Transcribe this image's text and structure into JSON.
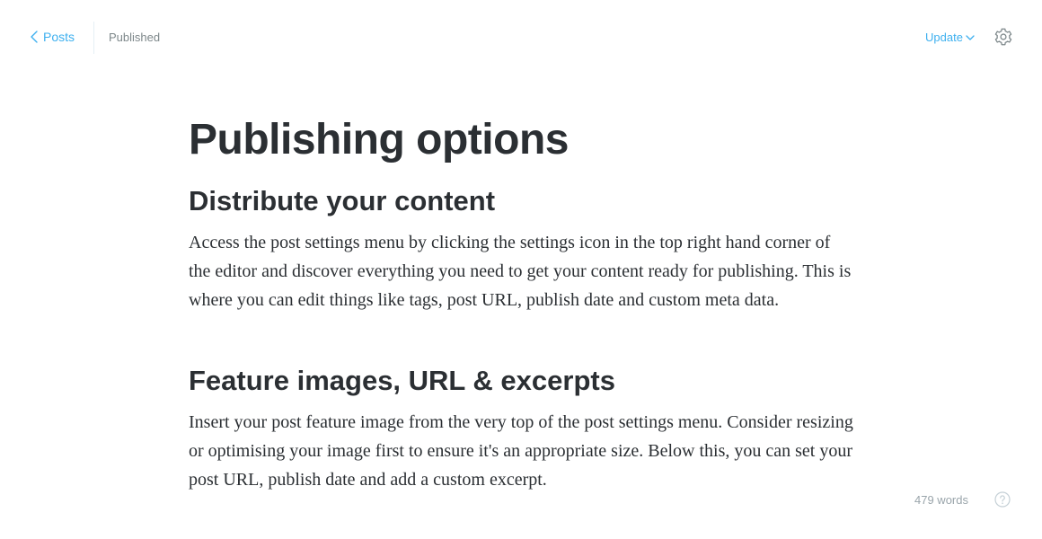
{
  "header": {
    "back_label": "Posts",
    "status": "Published",
    "update_label": "Update"
  },
  "icons": {
    "back": "chevron-left-icon",
    "dropdown": "chevron-down-icon",
    "settings": "gear-icon",
    "help": "help-icon"
  },
  "colors": {
    "accent": "#3eb0ef",
    "text": "#2b2f33",
    "muted": "#7d878a"
  },
  "post": {
    "title": "Publishing options",
    "sections": [
      {
        "heading": "Distribute your content",
        "body": "Access the post settings menu by clicking the settings icon in the top right hand corner of the editor and discover everything you need to get your content ready for publishing. This is where you can edit things like tags, post URL, publish date and custom meta data."
      },
      {
        "heading": "Feature images, URL & excerpts",
        "body": "Insert your post feature image from the very top of the post settings menu. Consider resizing or optimising your image first to ensure it's an appropriate size. Below this, you can set your post URL, publish date and add a custom excerpt."
      }
    ]
  },
  "footer": {
    "word_count": "479 words"
  }
}
